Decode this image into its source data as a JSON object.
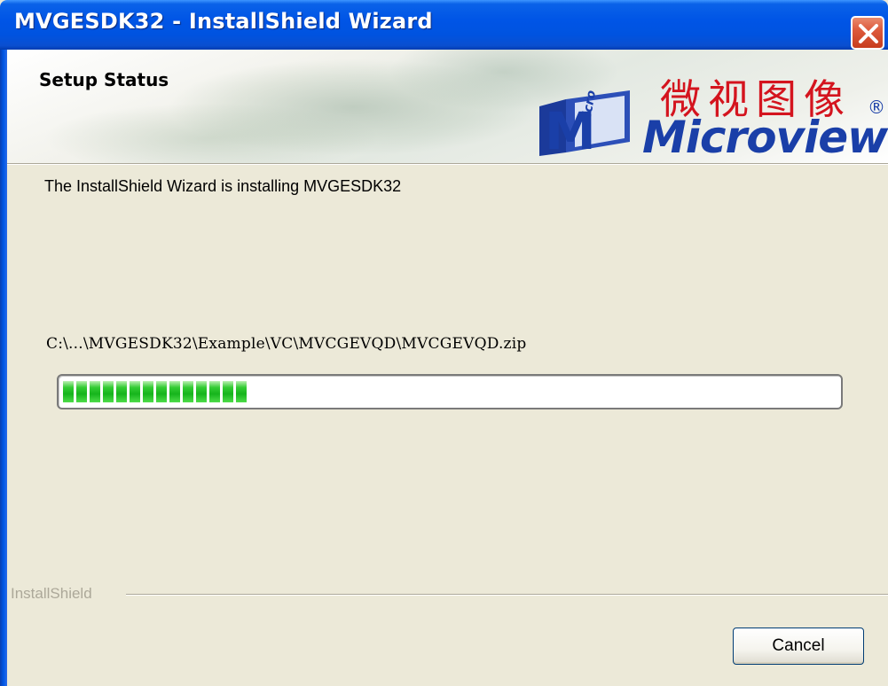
{
  "window": {
    "title": "MVGESDK32 - InstallShield Wizard",
    "close_icon": "close-icon"
  },
  "header": {
    "section_title": "Setup Status",
    "logo_chinese": "微视图像",
    "logo_registered": "®",
    "logo_english": "Microview",
    "logo_badge_text": "icro view"
  },
  "body": {
    "status_text": "The InstallShield Wizard is installing MVGESDK32",
    "current_file": "C:\\...\\MVGESDK32\\Example\\VC\\MVCGEVQD\\MVCGEVQD.zip",
    "progress_fraction": 0.26,
    "progress_segments": 14
  },
  "footer": {
    "brand_label": "InstallShield",
    "cancel_label": "Cancel"
  },
  "colors": {
    "titlebar": "#0055e6",
    "window_bg": "#ece9d8",
    "progress_fill": "#22c322",
    "logo_red": "#d4141e",
    "logo_blue": "#1a3fa8"
  }
}
